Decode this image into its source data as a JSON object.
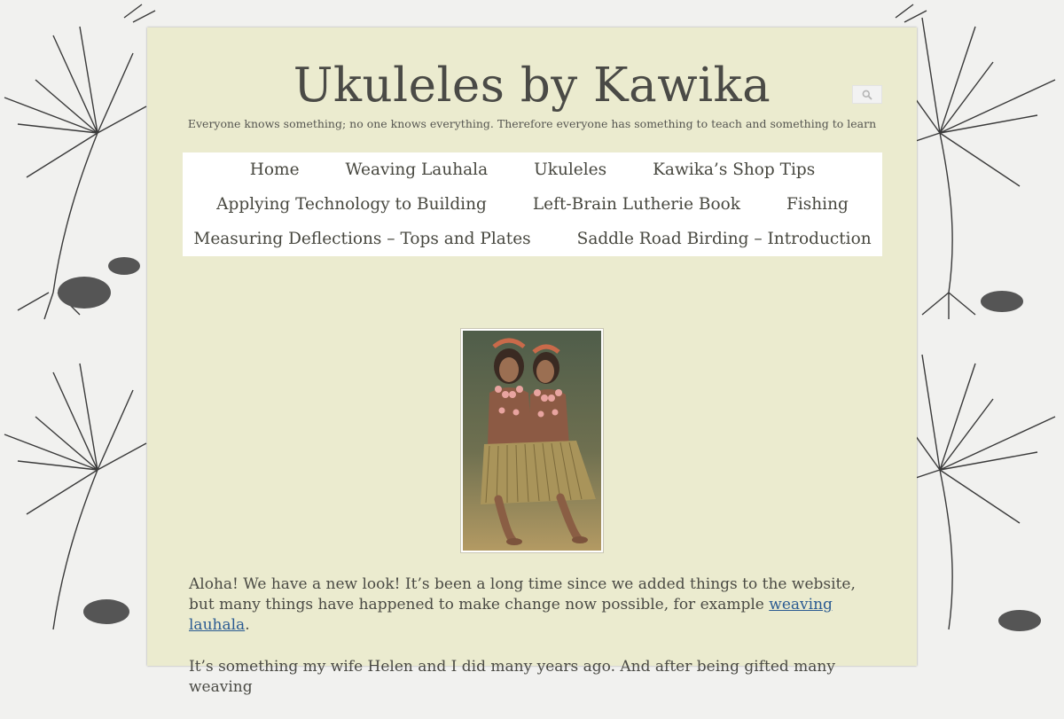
{
  "site": {
    "title": "Ukuleles by Kawika",
    "tagline": "Everyone knows something; no one knows everything. Therefore everyone has something to teach and something to learn"
  },
  "search": {
    "icon": "search-icon"
  },
  "nav": {
    "row1": [
      "Home",
      "Weaving Lauhala",
      "Ukuleles",
      "Kawika’s Shop Tips"
    ],
    "row2": [
      "Applying Technology to Building",
      "Left-Brain Lutherie Book",
      "Fishing"
    ],
    "row3": [
      "Measuring Deflections – Tops and Plates",
      "Saddle Road Birding – Introduction"
    ]
  },
  "content": {
    "p1_before": "Aloha! We have a new look! It’s been a long time since we added things to the website, but many things have happened to make change now possible, for example ",
    "p1_link": "weaving lauhala",
    "p1_after": ".",
    "p2": "It’s something my wife Helen and I did many years ago. And after being gifted many weaving"
  },
  "colors": {
    "page_bg": "#ebebcf",
    "body_bg": "#f1f1ef",
    "link": "#2b5b92",
    "text": "#4a4a44",
    "nav_bg": "#ffffff"
  }
}
